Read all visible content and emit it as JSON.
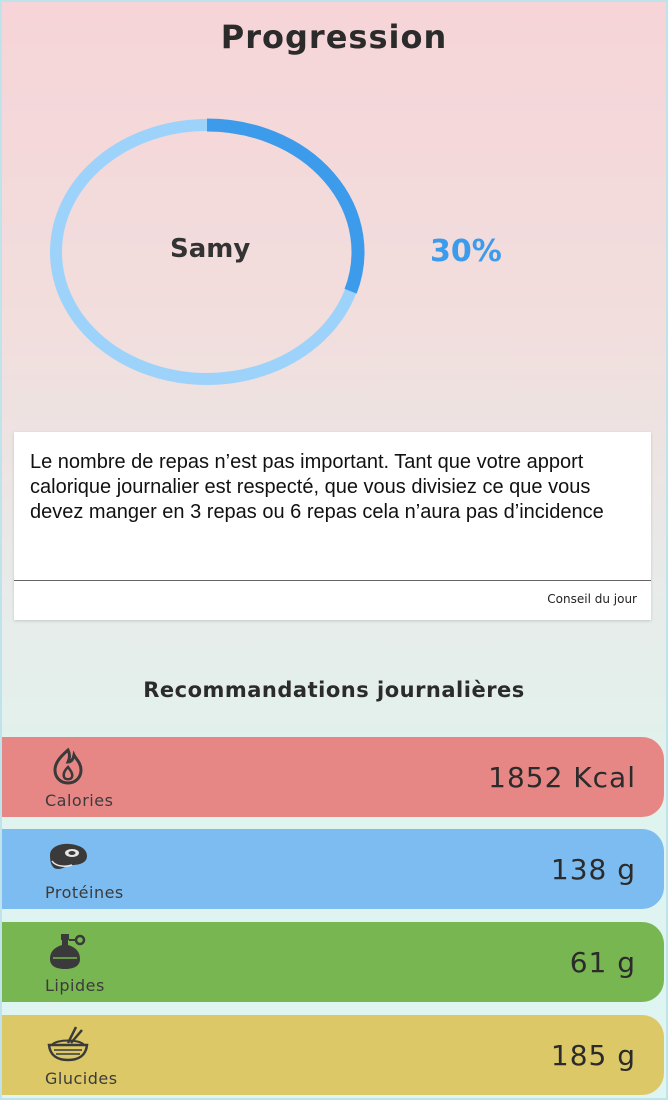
{
  "title": "Progression",
  "progress": {
    "user_name": "Samy",
    "percent_label": "30%",
    "fraction": 0.3,
    "colors": {
      "track": "#9dd3fb",
      "fill": "#3d9bec"
    }
  },
  "tip": {
    "text": "Le nombre de repas n’est pas important. Tant que votre apport calorique journalier est respecté, que vous divisiez ce que vous devez manger en 3 repas ou 6 repas cela n’aura pas d’incidence",
    "footer": "Conseil du jour"
  },
  "recommendations": {
    "title": "Recommandations journalières",
    "items": [
      {
        "label": "Calories",
        "value": "1852 Kcal",
        "icon": "flame-icon",
        "color": "#e78785"
      },
      {
        "label": "Protéines",
        "value": "138 g",
        "icon": "steak-icon",
        "color": "#7cbcf0"
      },
      {
        "label": "Lipides",
        "value": "61 g",
        "icon": "oil-bottle-icon",
        "color": "#78b651"
      },
      {
        "label": "Glucides",
        "value": "185 g",
        "icon": "rice-bowl-icon",
        "color": "#dcc867"
      }
    ]
  }
}
